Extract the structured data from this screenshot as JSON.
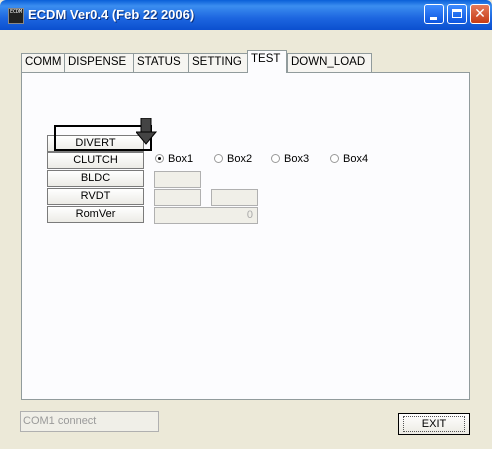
{
  "window": {
    "title": "ECDM Ver0.4 (Feb 22 2006)",
    "icon_label": "ECDM",
    "controls": {
      "minimize": "minimize-icon",
      "maximize": "maximize-icon",
      "close": "close-icon"
    }
  },
  "tabs": [
    {
      "label": "COMM",
      "active": false
    },
    {
      "label": "DISPENSE",
      "active": false
    },
    {
      "label": "STATUS",
      "active": false
    },
    {
      "label": "SETTING",
      "active": false
    },
    {
      "label": "TEST",
      "active": true
    },
    {
      "label": "DOWN_LOAD",
      "active": false
    }
  ],
  "test_panel": {
    "buttons": {
      "divert": "DIVERT",
      "clutch": "CLUTCH",
      "bldc": "BLDC",
      "rvdt": "RVDT",
      "romver": "RomVer"
    },
    "radios": [
      {
        "label": "Box1",
        "checked": true
      },
      {
        "label": "Box2",
        "checked": false
      },
      {
        "label": "Box3",
        "checked": false
      },
      {
        "label": "Box4",
        "checked": false
      }
    ],
    "bldc_value": "",
    "rvdt_value1": "",
    "rvdt_value2": "",
    "romver_value": "0"
  },
  "annotation": {
    "arrow": "down-arrow-icon",
    "color": "#000000"
  },
  "status_box": {
    "text": "COM1 connect"
  },
  "exit_button": {
    "label": "EXIT"
  }
}
